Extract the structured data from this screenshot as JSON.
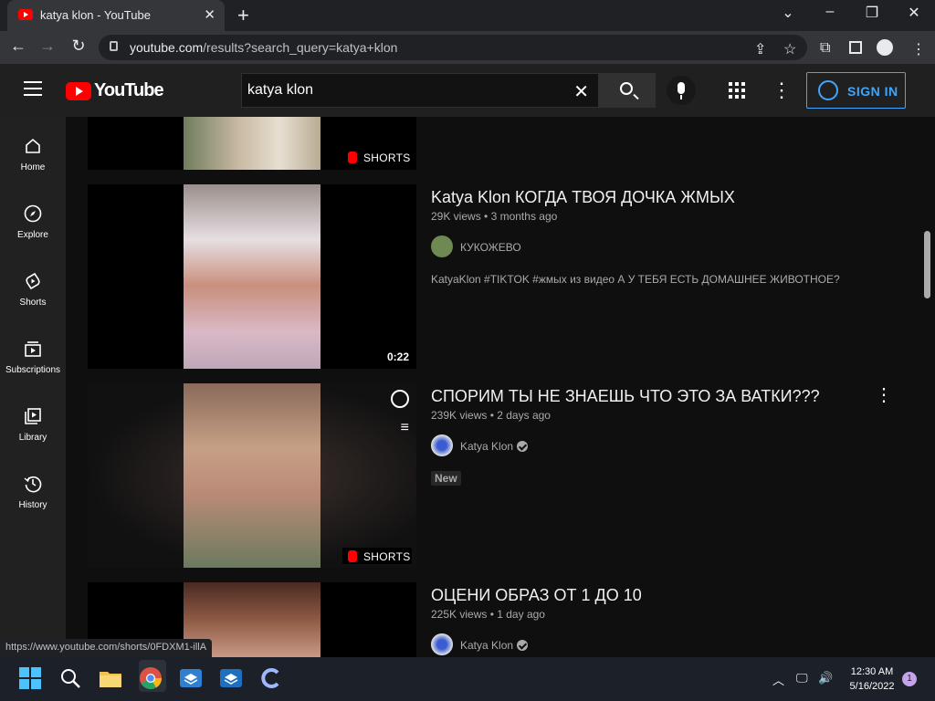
{
  "browser": {
    "tab_title": "katya klon - YouTube",
    "url_host": "youtube.com",
    "url_path": "/results?search_query=katya+klon",
    "status_url": "https://www.youtube.com/shorts/0FDXM1-illA"
  },
  "youtube": {
    "logo_text": "YouTube",
    "search_value": "katya klon",
    "sign_in_label": "SIGN IN"
  },
  "sidebar": {
    "items": [
      {
        "label": "Home",
        "icon": "home-icon"
      },
      {
        "label": "Explore",
        "icon": "compass-icon"
      },
      {
        "label": "Shorts",
        "icon": "shorts-icon"
      },
      {
        "label": "Subscriptions",
        "icon": "subscriptions-icon"
      },
      {
        "label": "Library",
        "icon": "library-icon"
      },
      {
        "label": "History",
        "icon": "history-icon"
      }
    ]
  },
  "results": [
    {
      "badge": "SHORTS"
    },
    {
      "title": "Katya Klon КОГДА ТВОЯ ДОЧКА ЖМЫХ",
      "views": "29K views",
      "age": "3 months ago",
      "channel": "КУКОЖЕВО",
      "description": "KatyaKlon #TIKTOK #жмых из видео А У ТЕБЯ ЕСТЬ ДОМАШНЕЕ ЖИВОТНОЕ?",
      "duration": "0:22"
    },
    {
      "title": "СПОРИМ ТЫ НЕ ЗНАЕШЬ ЧТО ЭТО ЗА ВАТКИ???",
      "views": "239K views",
      "age": "2 days ago",
      "channel": "Katya Klon",
      "tag": "New",
      "badge": "SHORTS"
    },
    {
      "title": "ОЦЕНИ ОБРАЗ ОТ 1 ДО 10",
      "views": "225K views",
      "age": "1 day ago",
      "channel": "Katya Klon"
    }
  ],
  "taskbar": {
    "time": "12:30 AM",
    "date": "5/16/2022",
    "notification_count": "1"
  },
  "colors": {
    "youtube_red": "#ff0000",
    "link_blue": "#3ea6ff",
    "page_bg": "#0f0f0f"
  }
}
